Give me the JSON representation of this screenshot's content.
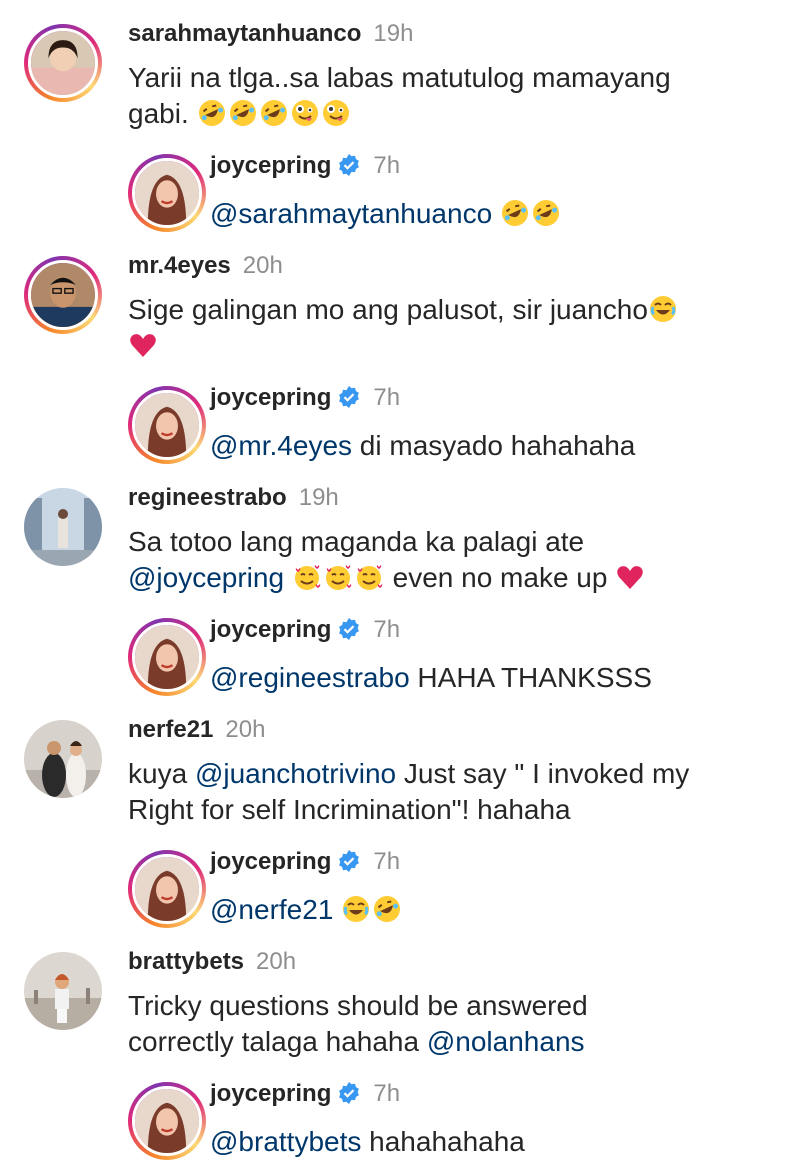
{
  "comments": [
    {
      "username": "sarahmaytanhuanco",
      "time": "19h",
      "line1": "Yarii na tlga..sa labas matutulog mamayang",
      "line2": "gabi.",
      "reply": {
        "username": "joycepring",
        "time": "7h",
        "mention": "@sarahmaytanhuanco",
        "text": ""
      }
    },
    {
      "username": "mr.4eyes",
      "time": "20h",
      "line1": "Sige galingan mo ang palusot, sir juancho",
      "reply": {
        "username": "joycepring",
        "time": "7h",
        "mention": "@mr.4eyes",
        "text": " di masyado hahahaha"
      }
    },
    {
      "username": "regineestrabo",
      "time": "19h",
      "line1": "Sa totoo lang maganda ka palagi ate",
      "mention": "@joycepring",
      "line2_after": " even no make up",
      "reply": {
        "username": "joycepring",
        "time": "7h",
        "mention": "@regineestrabo",
        "text": " HAHA THANKSSS"
      }
    },
    {
      "username": "nerfe21",
      "time": "20h",
      "prefix": "kuya ",
      "mention": "@juanchotrivino",
      "line1_after": " Just say \" I invoked my",
      "line2": "Right for self Incrimination\"! hahaha",
      "reply": {
        "username": "joycepring",
        "time": "7h",
        "mention": "@nerfe21",
        "text": ""
      }
    },
    {
      "username": "brattybets",
      "time": "20h",
      "line1": "Tricky questions should be answered",
      "line2": "correctly talaga hahaha ",
      "mention": "@nolanhans",
      "reply": {
        "username": "joycepring",
        "time": "7h",
        "mention": "@brattybets",
        "text": " hahahahaha"
      }
    }
  ],
  "icons": {
    "verified": "verified-badge-icon",
    "rofl": "rolling-on-floor-laughing-emoji",
    "zany": "zany-face-emoji",
    "joy": "face-with-tears-of-joy-emoji",
    "hearts": "smiling-face-with-hearts-emoji",
    "heart": "red-heart-emoji"
  },
  "colors": {
    "mention": "#00376b",
    "verified": "#3897f0",
    "heart": "#e0245e",
    "emoji": "#ffcc33"
  }
}
